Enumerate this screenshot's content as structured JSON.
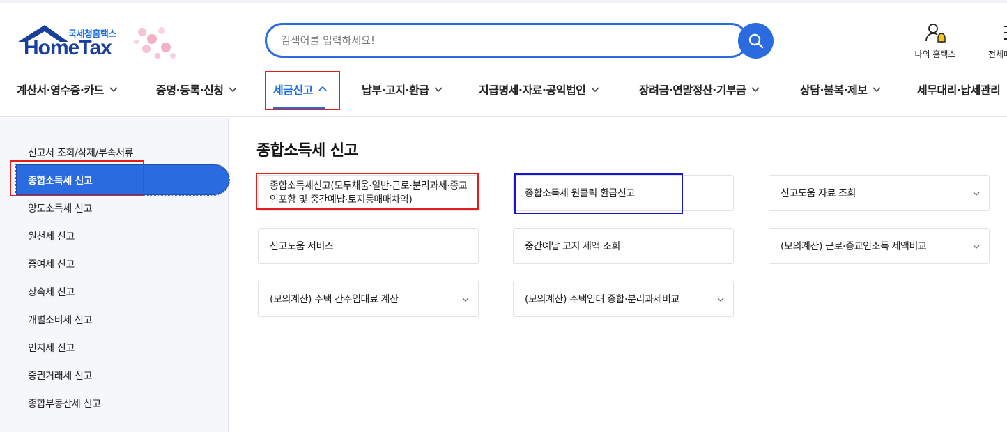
{
  "header": {
    "logo_sub": "국세청홈택스",
    "logo_main": "HomeTax",
    "search_placeholder": "검색어를 입력하세요!",
    "my_hometax": "나의 홈택스",
    "all_menu": "전체메뉴"
  },
  "gnb": {
    "items": [
      {
        "label": "계산서·영수증·카드"
      },
      {
        "label": "증명·등록·신청"
      },
      {
        "label": "세금신고",
        "active": true
      },
      {
        "label": "납부·고지·환급"
      },
      {
        "label": "지급명세·자료·공익법인"
      },
      {
        "label": "장려금·연말정산·기부금"
      },
      {
        "label": "상담·불복·제보"
      },
      {
        "label": "세무대리·납세관리"
      }
    ]
  },
  "sidebar": {
    "items": [
      {
        "label": "신고서 조회/삭제/부속서류"
      },
      {
        "label": "종합소득세 신고",
        "active": true
      },
      {
        "label": "양도소득세 신고"
      },
      {
        "label": "원천세 신고"
      },
      {
        "label": "증여세 신고"
      },
      {
        "label": "상속세 신고"
      },
      {
        "label": "개별소비세 신고"
      },
      {
        "label": "인지세 신고"
      },
      {
        "label": "증권거래세 신고"
      },
      {
        "label": "종합부동산세 신고"
      }
    ]
  },
  "main": {
    "title": "종합소득세 신고",
    "cards": [
      {
        "label": "종합소득세신고(모두채움·일반·근로·분리과세·종교인포함 및 중간예납·토지등매매차익)",
        "has_dropdown": false
      },
      {
        "label": "종합소득세 원클릭 환급신고",
        "has_dropdown": false
      },
      {
        "label": "신고도움 자료 조회",
        "has_dropdown": true
      },
      {
        "label": "신고도움 서비스",
        "has_dropdown": false
      },
      {
        "label": "중간예납 고지 세액 조회",
        "has_dropdown": false
      },
      {
        "label": "(모의계산) 근로·종교인소득 세액비교",
        "has_dropdown": true
      },
      {
        "label": "(모의계산) 주택 간주임대료 계산",
        "has_dropdown": true
      },
      {
        "label": "(모의계산) 주택임대 종합·분리과세비교",
        "has_dropdown": true
      }
    ]
  },
  "colors": {
    "accent": "#2a6be0",
    "highlight_red": "#e41e1e",
    "highlight_blue": "#1515d0"
  }
}
